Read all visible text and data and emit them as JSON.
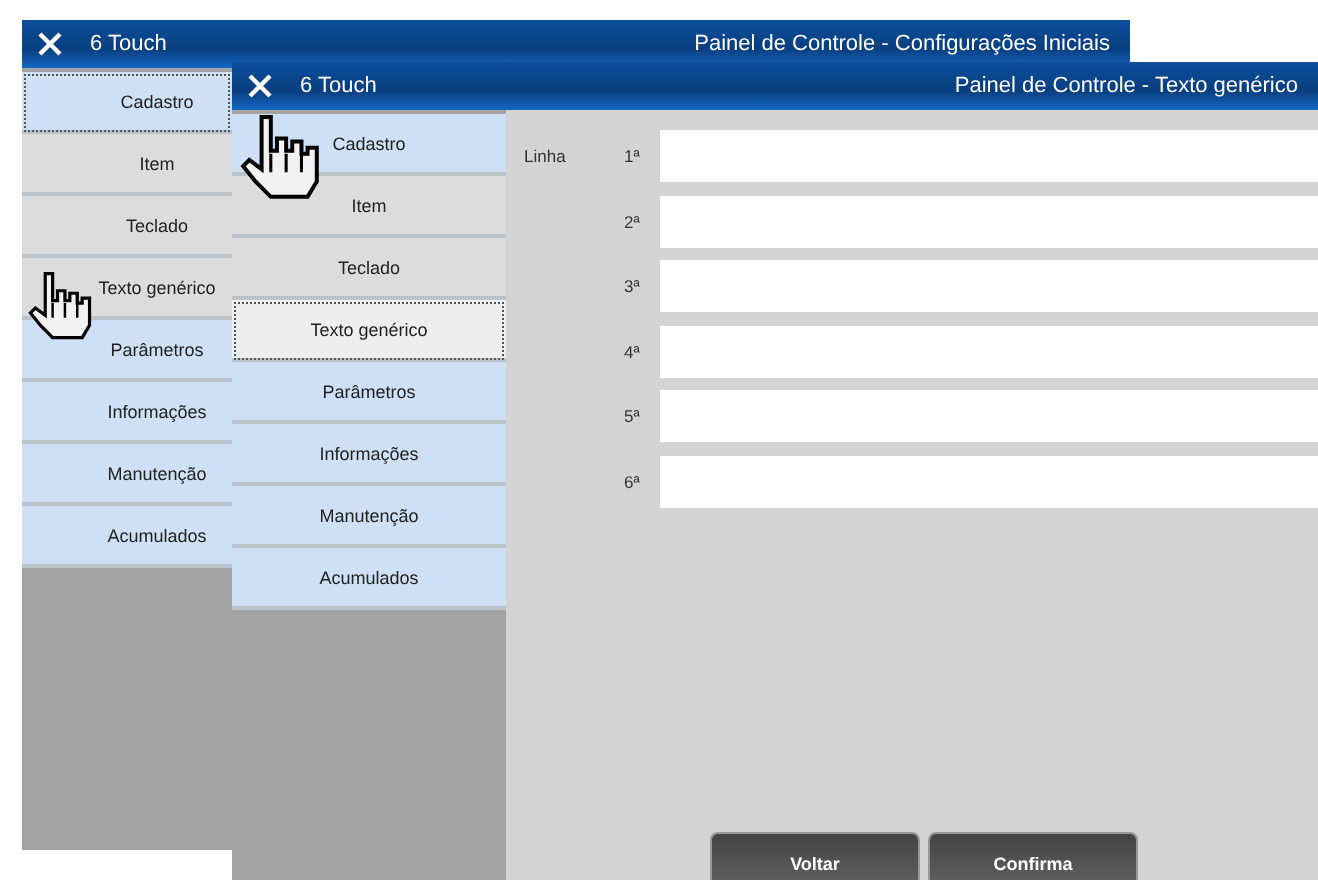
{
  "windows": [
    {
      "brand": "6 Touch",
      "title": "Painel de Controle - Configurações Iniciais",
      "menu": [
        {
          "label": "Cadastro",
          "kind": "blue",
          "selected": true
        },
        {
          "label": "Item",
          "kind": "gray",
          "selected": false
        },
        {
          "label": "Teclado",
          "kind": "gray",
          "selected": false
        },
        {
          "label": "Texto genérico",
          "kind": "gray",
          "selected": false
        },
        {
          "label": "Parâmetros",
          "kind": "blue",
          "selected": false
        },
        {
          "label": "Informações",
          "kind": "blue",
          "selected": false
        },
        {
          "label": "Manutenção",
          "kind": "blue",
          "selected": false
        },
        {
          "label": "Acumulados",
          "kind": "blue",
          "selected": false
        }
      ]
    },
    {
      "brand": "6 Touch",
      "title": "Painel de Controle - Texto genérico",
      "menu": [
        {
          "label": "Cadastro",
          "kind": "blue",
          "selected": false
        },
        {
          "label": "Item",
          "kind": "gray",
          "selected": false
        },
        {
          "label": "Teclado",
          "kind": "gray",
          "selected": false
        },
        {
          "label": "Texto genérico",
          "kind": "gray",
          "selected": true
        },
        {
          "label": "Parâmetros",
          "kind": "blue",
          "selected": false
        },
        {
          "label": "Informações",
          "kind": "blue",
          "selected": false
        },
        {
          "label": "Manutenção",
          "kind": "blue",
          "selected": false
        },
        {
          "label": "Acumulados",
          "kind": "blue",
          "selected": false
        }
      ],
      "form": {
        "label": "Linha",
        "lines": [
          {
            "label": "1ª"
          },
          {
            "label": "2ª"
          },
          {
            "label": "3ª"
          },
          {
            "label": "4ª"
          },
          {
            "label": "5ª"
          },
          {
            "label": "6ª"
          }
        ]
      },
      "buttons": [
        "Voltar",
        "Confirma"
      ]
    }
  ]
}
